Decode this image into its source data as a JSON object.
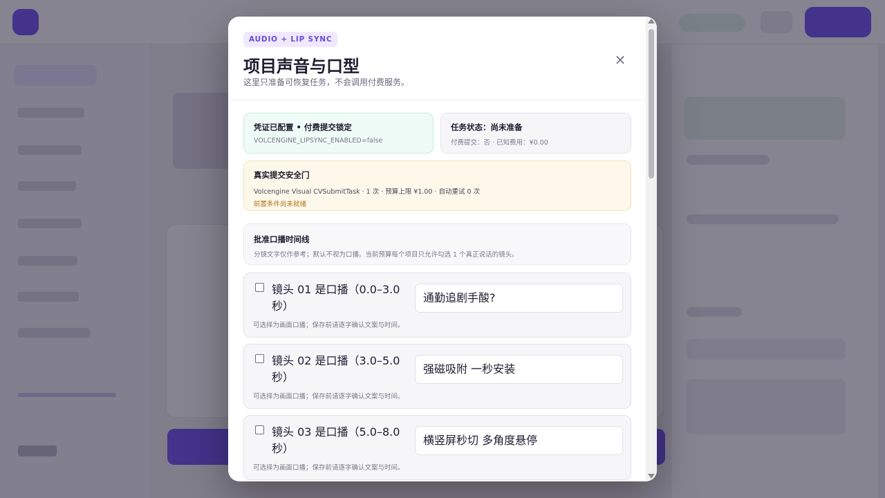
{
  "modal": {
    "tag": "AUDIO + LIP SYNC",
    "title": "项目声音与口型",
    "subtitle": "这里只准备可恢复任务，不会调用付费服务。",
    "close_icon": "×"
  },
  "credentials_status": {
    "title": "凭证已配置 • 付费提交锁定",
    "detail": "VOLCENGINE_LIPSYNC_ENABLED=false",
    "color": "#effbf6"
  },
  "task_status": {
    "title": "任务状态：尚未准备",
    "detail": "付费提交：否 · 已知费用：¥0.00"
  },
  "safety_gate": {
    "title": "真实提交安全门",
    "detail": "Volcengine Visual CVSubmitTask · 1 次 · 预算上限 ¥1.00 · 自动重试 0 次",
    "warning": "前置条件尚未就绪",
    "warning_color": "#b2721a"
  },
  "timeline": {
    "title": "批准口播时间线",
    "description": "分镜文字仅作参考；默认不视为口播。当前预算每个项目只允许勾选 1 个真正说话的镜头。"
  },
  "shots": [
    {
      "label": "镜头 01 是口播（0.0–3.0 秒）",
      "checked": false,
      "note": "可选择为画面口播；保存前请逐字确认文案与时间。",
      "text": "通勤追剧手酸?"
    },
    {
      "label": "镜头 02 是口播（3.0–5.0 秒）",
      "checked": false,
      "note": "可选择为画面口播；保存前请逐字确认文案与时间。",
      "text": "强磁吸附 一秒安装"
    },
    {
      "label": "镜头 03 是口播（5.0–8.0 秒）",
      "checked": false,
      "note": "可选择为画面口播；保存前请逐字确认文案与时间。",
      "text": "横竖屏秒切 多角度悬停"
    }
  ]
}
